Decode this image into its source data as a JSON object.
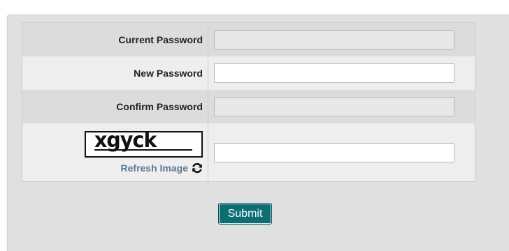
{
  "form": {
    "current_password": {
      "label": "Current Password",
      "value": "",
      "placeholder": ""
    },
    "new_password": {
      "label": "New Password",
      "value": "",
      "placeholder": ""
    },
    "confirm_password": {
      "label": "Confirm Password",
      "value": "",
      "placeholder": ""
    },
    "captcha": {
      "image_text": "xgyck",
      "refresh_label": "Refresh Image",
      "refresh_icon": "refresh-icon",
      "value": ""
    },
    "submit_label": "Submit"
  },
  "colors": {
    "submit_bg": "#0b6e73",
    "refresh_link": "#5a7a94",
    "panel_bg": "#e0e0e0"
  }
}
